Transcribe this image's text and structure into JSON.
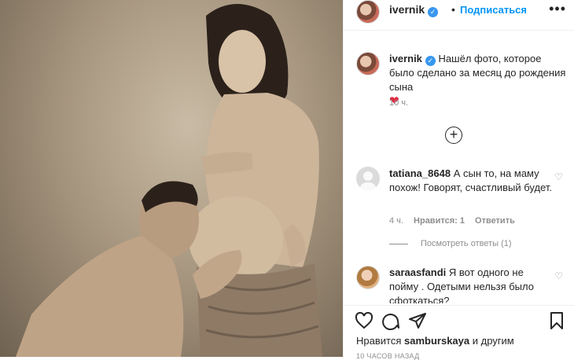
{
  "post": {
    "author": "ivernik",
    "follow_label": "Подписаться",
    "separator": "•",
    "more_label": "•••",
    "verified_mark": "✓"
  },
  "caption": {
    "author": "ivernik",
    "text": "Нашёл фото, которое было сделано за месяц до рождения сына",
    "emoji": "❤",
    "time": "10 ч."
  },
  "load_more_label": "+",
  "comments": [
    {
      "author": "tatiana_8648",
      "text": "А сын то, на маму похож! Говорят, счастливый будет.",
      "time": "4 ч.",
      "likes": "Нравится: 1",
      "reply": "Ответить",
      "replies": "Посмотреть ответы (1)"
    },
    {
      "author": "saraasfandi",
      "text": "Я вот одного не пойму . Одетыми нельзя было сфоткаться?"
    }
  ],
  "likes": {
    "prefix": "Нравится",
    "user": "samburskaya",
    "suffix": "и другим"
  },
  "post_time": "10 ЧАСОВ НАЗАД",
  "colors": {
    "accent": "#0095f6",
    "verified": "#3897f0",
    "heart": "#e0263a",
    "muted": "#8e8e8e"
  },
  "icons": [
    "verified-icon",
    "more-icon",
    "heart-icon",
    "add-comment-icon",
    "comment-icon",
    "share-icon",
    "bookmark-icon"
  ]
}
